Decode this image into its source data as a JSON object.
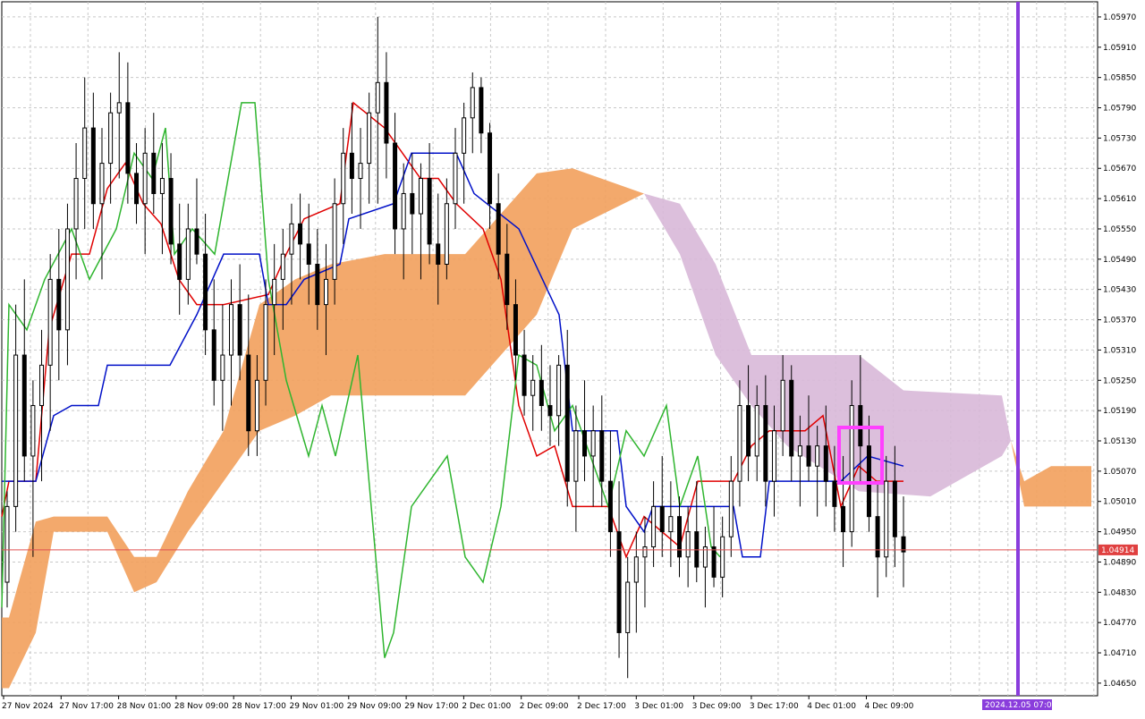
{
  "colors": {
    "background": "#ffffff",
    "grid": "#c8c8c8",
    "bull_candle": "#ffffff",
    "bear_candle": "#000000",
    "blue_candle": "#2a6fb5",
    "tenkan": "#e00000",
    "kijun": "#0010c8",
    "chikou": "#2fb52f",
    "kumo_bull": "#f2a05c",
    "kumo_bear": "#d8b8d8",
    "price_line": "#e05050",
    "price_tag": "#e04040",
    "vline": "#8a3ddc",
    "future_tag": "#8a3ddc",
    "highlight": "#ff40ff"
  },
  "axis": {
    "price_labels": [
      "1.05970",
      "1.05910",
      "1.05850",
      "1.05790",
      "1.05730",
      "1.05670",
      "1.05610",
      "1.05550",
      "1.05490",
      "1.05430",
      "1.05370",
      "1.05310",
      "1.05250",
      "1.05190",
      "1.05130",
      "1.05070",
      "1.05010",
      "1.04950",
      "1.04890",
      "1.04830",
      "1.04770",
      "1.04710",
      "1.04650"
    ],
    "time_labels": [
      "27 Nov 2024",
      "27 Nov 17:00",
      "28 Nov 01:00",
      "28 Nov 09:00",
      "28 Nov 17:00",
      "29 Nov 01:00",
      "29 Nov 09:00",
      "29 Nov 17:00",
      "2 Dec 01:00",
      "2 Dec 09:00",
      "2 Dec 17:00",
      "3 Dec 01:00",
      "3 Dec 09:00",
      "3 Dec 17:00",
      "4 Dec 01:00",
      "4 Dec 09:00"
    ],
    "current_price": "1.04914",
    "future_time_label": "2024.12.05 07:00"
  },
  "chart_data": {
    "type": "candlestick",
    "ylim": [
      1.04625,
      1.06
    ],
    "candles_ohlc": [
      [
        1.0485,
        1.0503,
        1.048,
        1.05
      ],
      [
        1.05,
        1.054,
        1.0495,
        1.053
      ],
      [
        1.053,
        1.0545,
        1.0505,
        1.051
      ],
      [
        1.051,
        1.0525,
        1.049,
        1.052
      ],
      [
        1.052,
        1.0535,
        1.0505,
        1.0528
      ],
      [
        1.0528,
        1.055,
        1.0515,
        1.0545
      ],
      [
        1.0545,
        1.0555,
        1.0525,
        1.0535
      ],
      [
        1.0535,
        1.056,
        1.0528,
        1.0555
      ],
      [
        1.0555,
        1.0572,
        1.0545,
        1.0565
      ],
      [
        1.0565,
        1.0585,
        1.0555,
        1.0575
      ],
      [
        1.0575,
        1.0582,
        1.0555,
        1.056
      ],
      [
        1.056,
        1.0575,
        1.0545,
        1.0568
      ],
      [
        1.0568,
        1.0582,
        1.056,
        1.0578
      ],
      [
        1.0578,
        1.059,
        1.0565,
        1.058
      ],
      [
        1.058,
        1.0588,
        1.056,
        1.0566
      ],
      [
        1.0566,
        1.0572,
        1.0556,
        1.056
      ],
      [
        1.056,
        1.0575,
        1.055,
        1.057
      ],
      [
        1.057,
        1.0578,
        1.0558,
        1.0562
      ],
      [
        1.0562,
        1.0572,
        1.055,
        1.0565
      ],
      [
        1.0565,
        1.057,
        1.0548,
        1.0552
      ],
      [
        1.0552,
        1.056,
        1.0538,
        1.0545
      ],
      [
        1.0545,
        1.056,
        1.054,
        1.0555
      ],
      [
        1.0555,
        1.0565,
        1.0548,
        1.055
      ],
      [
        1.055,
        1.0558,
        1.053,
        1.0535
      ],
      [
        1.0535,
        1.0545,
        1.052,
        1.0525
      ],
      [
        1.0525,
        1.054,
        1.0515,
        1.053
      ],
      [
        1.053,
        1.0545,
        1.052,
        1.054
      ],
      [
        1.054,
        1.0548,
        1.0525,
        1.053
      ],
      [
        1.053,
        1.0542,
        1.051,
        1.0515
      ],
      [
        1.0515,
        1.053,
        1.051,
        1.0525
      ],
      [
        1.0525,
        1.0545,
        1.052,
        1.054
      ],
      [
        1.054,
        1.0552,
        1.053,
        1.0545
      ],
      [
        1.0545,
        1.0555,
        1.0535,
        1.055
      ],
      [
        1.055,
        1.056,
        1.054,
        1.0556
      ],
      [
        1.0556,
        1.0562,
        1.0545,
        1.0552
      ],
      [
        1.0552,
        1.056,
        1.054,
        1.0548
      ],
      [
        1.0548,
        1.0555,
        1.0535,
        1.054
      ],
      [
        1.054,
        1.0552,
        1.053,
        1.0545
      ],
      [
        1.0545,
        1.0565,
        1.054,
        1.056
      ],
      [
        1.056,
        1.0575,
        1.0552,
        1.057
      ],
      [
        1.057,
        1.058,
        1.0558,
        1.0565
      ],
      [
        1.0565,
        1.0575,
        1.0555,
        1.0568
      ],
      [
        1.0568,
        1.0582,
        1.056,
        1.0578
      ],
      [
        1.0578,
        1.0597,
        1.056,
        1.0584
      ],
      [
        1.0584,
        1.059,
        1.0565,
        1.0572
      ],
      [
        1.0572,
        1.0578,
        1.055,
        1.0555
      ],
      [
        1.0555,
        1.0568,
        1.0545,
        1.0562
      ],
      [
        1.0562,
        1.057,
        1.055,
        1.0558
      ],
      [
        1.0558,
        1.0568,
        1.0545,
        1.0565
      ],
      [
        1.0565,
        1.0572,
        1.0548,
        1.0552
      ],
      [
        1.0552,
        1.0562,
        1.054,
        1.0548
      ],
      [
        1.0548,
        1.0565,
        1.0545,
        1.056
      ],
      [
        1.056,
        1.0575,
        1.0555,
        1.057
      ],
      [
        1.057,
        1.058,
        1.056,
        1.0577
      ],
      [
        1.0577,
        1.0586,
        1.057,
        1.0583
      ],
      [
        1.0583,
        1.0585,
        1.057,
        1.0574
      ],
      [
        1.0574,
        1.0576,
        1.0555,
        1.056
      ],
      [
        1.056,
        1.0566,
        1.0545,
        1.055
      ],
      [
        1.055,
        1.0556,
        1.0535,
        1.054
      ],
      [
        1.054,
        1.0545,
        1.0525,
        1.053
      ],
      [
        1.053,
        1.0535,
        1.0518,
        1.0522
      ],
      [
        1.0522,
        1.053,
        1.0515,
        1.0525
      ],
      [
        1.0525,
        1.0532,
        1.0515,
        1.052
      ],
      [
        1.052,
        1.0528,
        1.0512,
        1.0518
      ],
      [
        1.0518,
        1.053,
        1.0512,
        1.0528
      ],
      [
        1.0528,
        1.0535,
        1.05,
        1.0505
      ],
      [
        1.0505,
        1.052,
        1.0495,
        1.0515
      ],
      [
        1.0515,
        1.0525,
        1.0505,
        1.051
      ],
      [
        1.051,
        1.052,
        1.05,
        1.0515
      ],
      [
        1.0515,
        1.0522,
        1.05,
        1.0505
      ],
      [
        1.0505,
        1.0515,
        1.049,
        1.0495
      ],
      [
        1.0495,
        1.0505,
        1.047,
        1.0475
      ],
      [
        1.0475,
        1.049,
        1.0466,
        1.0485
      ],
      [
        1.0485,
        1.0495,
        1.0475,
        1.049
      ],
      [
        1.049,
        1.0498,
        1.048,
        1.0492
      ],
      [
        1.0492,
        1.0505,
        1.0488,
        1.05
      ],
      [
        1.05,
        1.051,
        1.049,
        1.0495
      ],
      [
        1.0495,
        1.0505,
        1.0488,
        1.0498
      ],
      [
        1.0498,
        1.0502,
        1.0486,
        1.049
      ],
      [
        1.049,
        1.05,
        1.0484,
        1.0495
      ],
      [
        1.0495,
        1.0505,
        1.0485,
        1.0488
      ],
      [
        1.0488,
        1.0496,
        1.048,
        1.0492
      ],
      [
        1.0492,
        1.05,
        1.0484,
        1.0486
      ],
      [
        1.0486,
        1.0498,
        1.0482,
        1.0494
      ],
      [
        1.0494,
        1.051,
        1.049,
        1.0505
      ],
      [
        1.0505,
        1.0525,
        1.05,
        1.052
      ],
      [
        1.052,
        1.0528,
        1.0505,
        1.051
      ],
      [
        1.051,
        1.0524,
        1.0505,
        1.052
      ],
      [
        1.052,
        1.0526,
        1.05,
        1.0505
      ],
      [
        1.0505,
        1.052,
        1.0498,
        1.0515
      ],
      [
        1.0515,
        1.053,
        1.051,
        1.0525
      ],
      [
        1.0525,
        1.0528,
        1.0505,
        1.051
      ],
      [
        1.051,
        1.0518,
        1.05,
        1.0512
      ],
      [
        1.0512,
        1.0522,
        1.0505,
        1.0508
      ],
      [
        1.0508,
        1.0516,
        1.0498,
        1.0512
      ],
      [
        1.0512,
        1.052,
        1.05,
        1.0505
      ],
      [
        1.0505,
        1.0512,
        1.0495,
        1.05
      ],
      [
        1.05,
        1.051,
        1.0488,
        1.0495
      ],
      [
        1.0495,
        1.0525,
        1.0492,
        1.052
      ],
      [
        1.052,
        1.053,
        1.0505,
        1.0512
      ],
      [
        1.0512,
        1.0518,
        1.0495,
        1.0498
      ],
      [
        1.0498,
        1.0505,
        1.0482,
        1.049
      ],
      [
        1.049,
        1.051,
        1.0486,
        1.0505
      ],
      [
        1.0505,
        1.0512,
        1.0488,
        1.0494
      ],
      [
        1.0494,
        1.0502,
        1.0484,
        1.0491
      ]
    ],
    "current_price": 1.04914
  }
}
